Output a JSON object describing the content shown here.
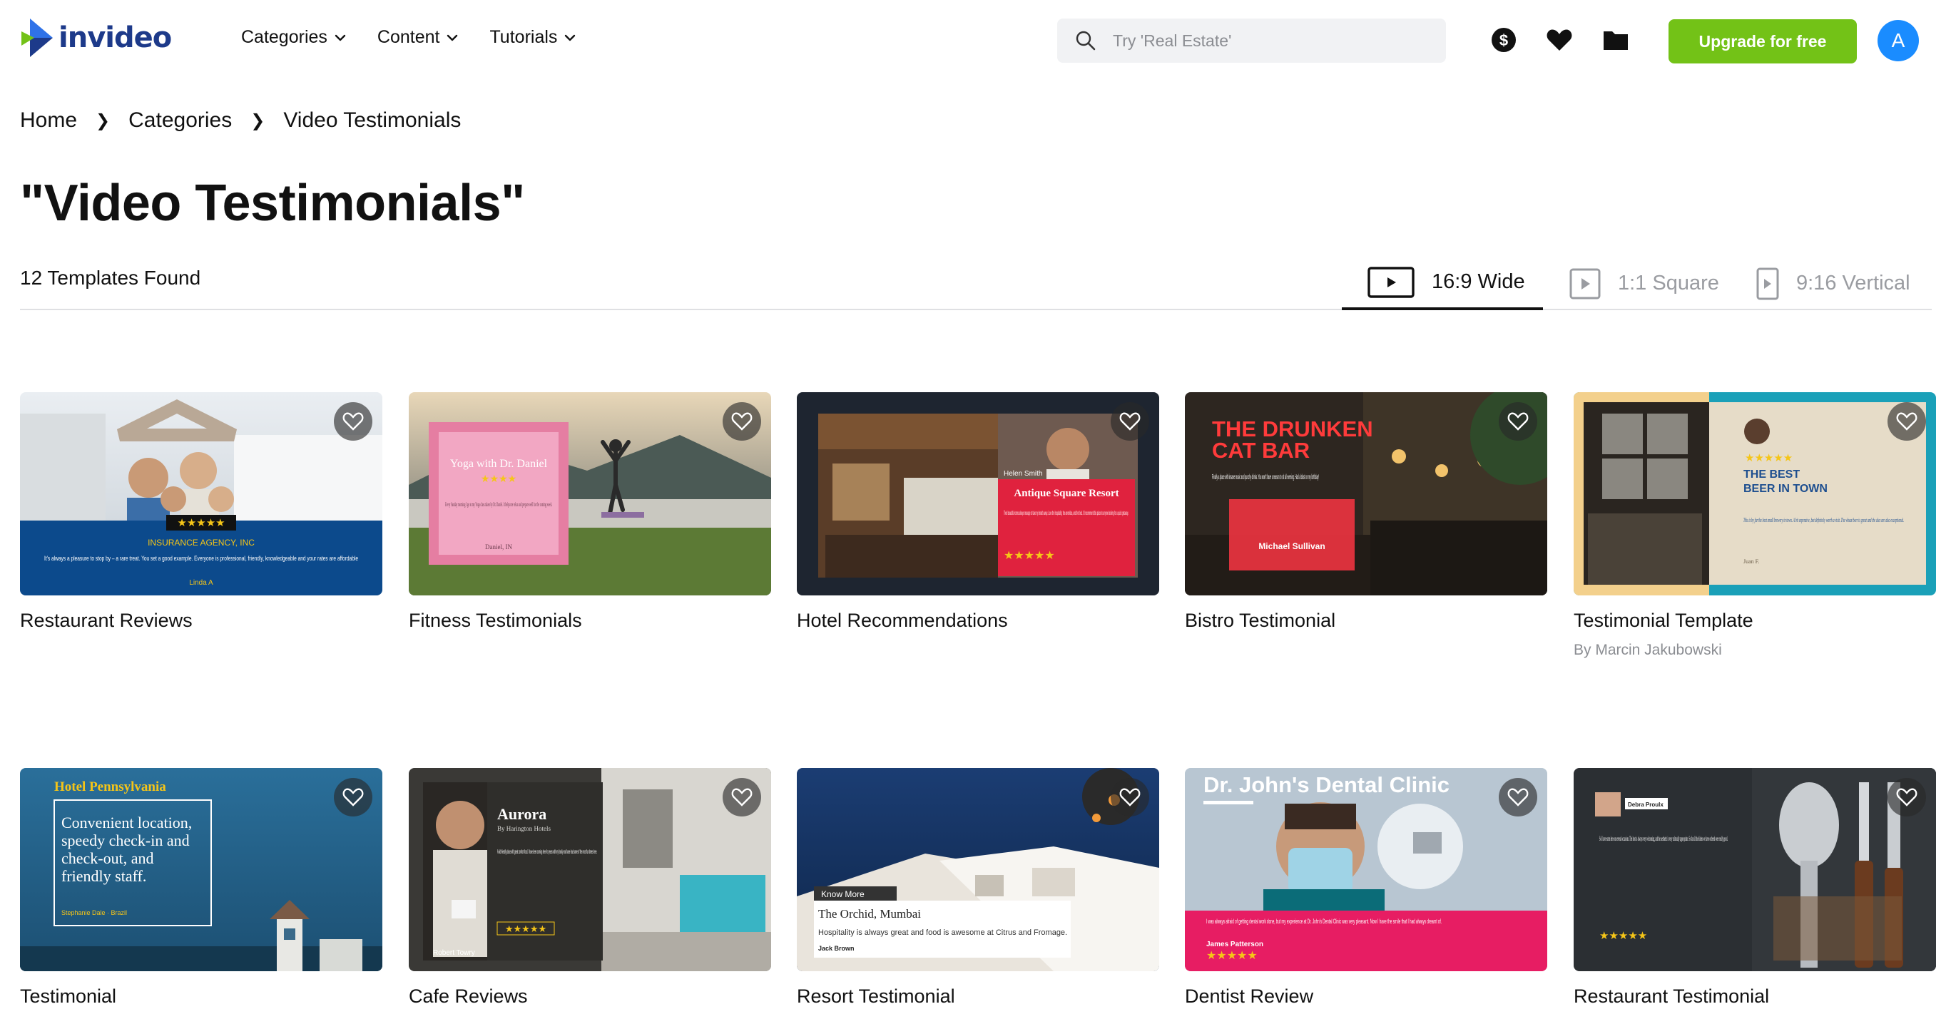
{
  "header": {
    "logo_text": "invideo",
    "nav": [
      {
        "label": "Categories"
      },
      {
        "label": "Content"
      },
      {
        "label": "Tutorials"
      }
    ],
    "search_placeholder": "Try 'Real Estate'",
    "upgrade_label": "Upgrade for free",
    "avatar_initial": "A",
    "icons": [
      "dollar-icon",
      "heart-icon",
      "folder-icon"
    ]
  },
  "breadcrumb": [
    "Home",
    "Categories",
    "Video Testimonials"
  ],
  "page_title": "\"Video Testimonials\"",
  "templates_found": "12 Templates Found",
  "tabs": [
    {
      "label": "16:9 Wide",
      "active": true
    },
    {
      "label": "1:1 Square",
      "active": false
    },
    {
      "label": "9:16 Vertical",
      "active": false
    }
  ],
  "colors": {
    "accent_green": "#73c217",
    "avatar_blue": "#1a8cff",
    "logo_navy": "#1d3a8a"
  },
  "templates": [
    {
      "title": "Restaurant Reviews",
      "author": "",
      "thumb": {
        "heading": "INSURANCE AGENCY, INC",
        "body": "It's always a pleasure to stop by – a rare treat. You set a good example. Everyone is professional, friendly, knowledgeable and your rates are affordable",
        "name": "Linda A",
        "stars": "★★★★★"
      }
    },
    {
      "title": "Fitness Testimonials",
      "author": "",
      "thumb": {
        "heading": "Yoga with Dr. Daniel",
        "body": "Every Sunday morning I go to my Yoga class taken by Dr. Daniel. It helps me relax and prepare well for the coming week.",
        "name": "Daniel, IN",
        "stars": "★★★★"
      }
    },
    {
      "title": "Hotel Recommendations",
      "author": "",
      "thumb": {
        "name": "Helen Smith",
        "heading": "Antique Square Resort",
        "body": "Their beautiful rooms always manage to take my breath away. Love the hospitality, the amenities, and the food. I'd recommend this place to anyone looking for a quick getaway.",
        "stars": "★★★★★"
      }
    },
    {
      "title": "Bistro Testimonial",
      "author": "",
      "thumb": {
        "heading_line1": "THE DRUNKEN",
        "heading_line2": "CAT BAR",
        "body": "Finally a place with insane music and punchy drinks. You won't have a reason to sit all evening. Had a blast on my birthday!",
        "name": "Michael Sullivan"
      }
    },
    {
      "title": "Testimonial Template",
      "author": "By Marcin Jakubowski",
      "thumb": {
        "stars": "★★★★★",
        "heading_line1": "THE BEST",
        "heading_line2": "BEER IN TOWN",
        "body": "This is by far the best small brewery in town. A bit expensive, but definitely worth a visit. The wheat beer is great and the ales are also exceptional.",
        "name": "Juan F."
      }
    },
    {
      "title": "Testimonial",
      "author": "",
      "thumb": {
        "heading": "Hotel Pennsylvania",
        "body_lines": [
          "Convenient location,",
          "speedy check-in and",
          "check-out, and",
          "friendly staff."
        ],
        "name": "Stephanie Dale · Brazil"
      }
    },
    {
      "title": "Cafe Reviews",
      "author": "",
      "thumb": {
        "heading": "Aurora",
        "subheading": "By Harington Hotels",
        "body": "A kid-friendly place with great comfort food. I have been coming here for years with my family and have had some of the most fun times here.",
        "stars": "★★★★★",
        "name": "Robert Towry"
      }
    },
    {
      "title": "Resort Testimonial",
      "author": "",
      "thumb": {
        "tag": "Know More",
        "heading": "The Orchid, Mumbai",
        "body": "Hospitality is always great and food is awesome at Citrus and Fromage.",
        "name": "Jack Brown"
      }
    },
    {
      "title": "Dentist Review",
      "author": "",
      "thumb": {
        "heading": "Dr. John's Dental Clinic",
        "body": "I was always afraid of getting dental work done, but my experience at Dr. John's Dental Clinic was very pleasant. Now I have the smile that I had always dreamt of.",
        "name": "James Patterson",
        "stars": "★★★★★"
      }
    },
    {
      "title": "Restaurant Testimonial",
      "author": "",
      "thumb": {
        "name": "Debra Proulx",
        "body": "So I have eaten here on several occasions. The host is always very welcoming, and the aesthetic is very culturally appropriate. So far all the dishes we have ordered were really good.",
        "stars": "★★★★★"
      }
    }
  ]
}
